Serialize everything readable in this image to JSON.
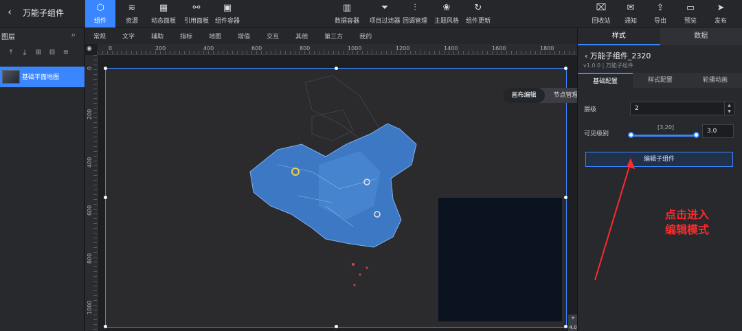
{
  "header": {
    "title": "万能子组件",
    "tools_left": [
      {
        "label": "组件",
        "icon": "component-icon",
        "glyph": "⬡",
        "active": true
      },
      {
        "label": "资源",
        "icon": "layers-icon",
        "glyph": "≋"
      },
      {
        "label": "动态面板",
        "icon": "grid-icon",
        "glyph": "▦"
      },
      {
        "label": "引用面板",
        "icon": "link-icon",
        "glyph": "⚯"
      },
      {
        "label": "组件容器",
        "icon": "container-icon",
        "glyph": "▣"
      }
    ],
    "tools_center": [
      {
        "label": "数据容器",
        "icon": "chart-icon",
        "glyph": "▥"
      },
      {
        "label": "项目过滤器",
        "icon": "filter-icon",
        "glyph": "⏷"
      },
      {
        "label": "回调管理",
        "icon": "sliders-icon",
        "glyph": "⫶"
      },
      {
        "label": "主题风格",
        "icon": "theme-icon",
        "glyph": "❀"
      },
      {
        "label": "组件更新",
        "icon": "refresh-icon",
        "glyph": "↻"
      }
    ],
    "tools_right": [
      {
        "label": "回收站",
        "icon": "trash-icon",
        "glyph": "🗑"
      },
      {
        "label": "通知",
        "icon": "bell-icon",
        "glyph": "✉"
      },
      {
        "label": "导出",
        "icon": "export-icon",
        "glyph": "⇪"
      },
      {
        "label": "预览",
        "icon": "preview-icon",
        "glyph": "▭"
      },
      {
        "label": "发布",
        "icon": "send-icon",
        "glyph": "➤"
      }
    ]
  },
  "layers": {
    "title": "图层",
    "item": "基础平面地图"
  },
  "categories": [
    "常规",
    "文字",
    "辅助",
    "指标",
    "地图",
    "增值",
    "交互",
    "其他",
    "第三方",
    "我的"
  ],
  "ruler": {
    "top": [
      "0",
      "200",
      "400",
      "600",
      "800",
      "1000",
      "1200",
      "1400",
      "1600",
      "1800"
    ],
    "left": [
      "0",
      "200",
      "400",
      "600",
      "800",
      "1000"
    ]
  },
  "canvas": {
    "mode_a": "画布编辑",
    "mode_b": "节点管理",
    "zoom_in": "+",
    "zoom_value": "4.0",
    "zoom_out": "-"
  },
  "panel": {
    "tab_style": "样式",
    "tab_data": "数据",
    "component_name": "万能子组件_2320",
    "version": "v1.0.0 | 万能子组件",
    "subtabs": [
      "基础配置",
      "样式配置",
      "轮播动画"
    ],
    "level_label": "层级",
    "level_value": "2",
    "visible_label": "可见级别",
    "visible_range": "[3,20]",
    "visible_value": "3.0",
    "edit_button": "编辑子组件"
  },
  "annotation": {
    "line1": "点击进入",
    "line2": "编辑模式"
  },
  "colors": {
    "accent": "#3a86ff",
    "annotation": "#ff2a2a"
  }
}
